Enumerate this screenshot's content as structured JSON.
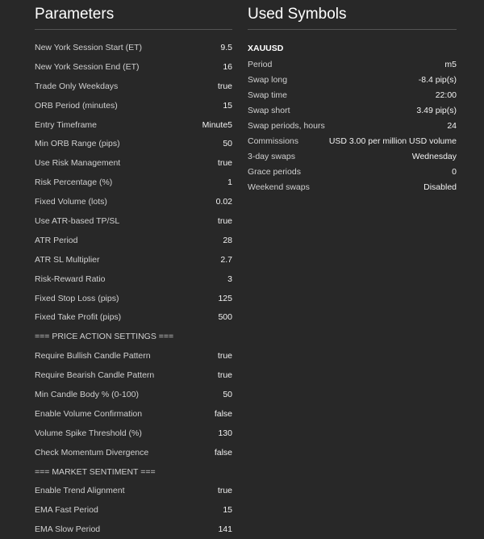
{
  "parameters": {
    "title": "Parameters",
    "rows": [
      {
        "name": "New York Session Start (ET)",
        "value": "9.5"
      },
      {
        "name": "New York Session End (ET)",
        "value": "16"
      },
      {
        "name": "Trade Only Weekdays",
        "value": "true"
      },
      {
        "name": "ORB Period (minutes)",
        "value": "15"
      },
      {
        "name": "Entry Timeframe",
        "value": "Minute5"
      },
      {
        "name": "Min ORB Range (pips)",
        "value": "50"
      },
      {
        "name": "Use Risk Management",
        "value": "true"
      },
      {
        "name": "Risk Percentage (%)",
        "value": "1"
      },
      {
        "name": "Fixed Volume (lots)",
        "value": "0.02"
      },
      {
        "name": "Use ATR-based TP/SL",
        "value": "true"
      },
      {
        "name": "ATR Period",
        "value": "28"
      },
      {
        "name": "ATR SL Multiplier",
        "value": "2.7"
      },
      {
        "name": "Risk-Reward Ratio",
        "value": "3"
      },
      {
        "name": "Fixed Stop Loss (pips)",
        "value": "125"
      },
      {
        "name": "Fixed Take Profit (pips)",
        "value": "500"
      },
      {
        "name": "=== PRICE ACTION SETTINGS ===",
        "value": ""
      },
      {
        "name": "Require Bullish Candle Pattern",
        "value": "true"
      },
      {
        "name": "Require Bearish Candle Pattern",
        "value": "true"
      },
      {
        "name": "Min Candle Body % (0-100)",
        "value": "50"
      },
      {
        "name": "Enable Volume Confirmation",
        "value": "false"
      },
      {
        "name": "Volume Spike Threshold (%)",
        "value": "130"
      },
      {
        "name": "Check Momentum Divergence",
        "value": "false"
      },
      {
        "name": "=== MARKET SENTIMENT ===",
        "value": ""
      },
      {
        "name": "Enable Trend Alignment",
        "value": "true"
      },
      {
        "name": "EMA Fast Period",
        "value": "15"
      },
      {
        "name": "EMA Slow Period",
        "value": "141"
      }
    ]
  },
  "used_symbols": {
    "title": "Used Symbols",
    "symbol": "XAUUSD",
    "rows": [
      {
        "name": "Period",
        "value": "m5"
      },
      {
        "name": "Swap long",
        "value": "-8.4 pip(s)"
      },
      {
        "name": "Swap time",
        "value": "22:00"
      },
      {
        "name": "Swap short",
        "value": "3.49 pip(s)"
      },
      {
        "name": "Swap periods, hours",
        "value": "24"
      },
      {
        "name": "Commissions",
        "value": "USD 3.00 per million USD volume"
      },
      {
        "name": "3-day swaps",
        "value": "Wednesday"
      },
      {
        "name": "Grace periods",
        "value": "0"
      },
      {
        "name": "Weekend swaps",
        "value": "Disabled"
      }
    ]
  }
}
